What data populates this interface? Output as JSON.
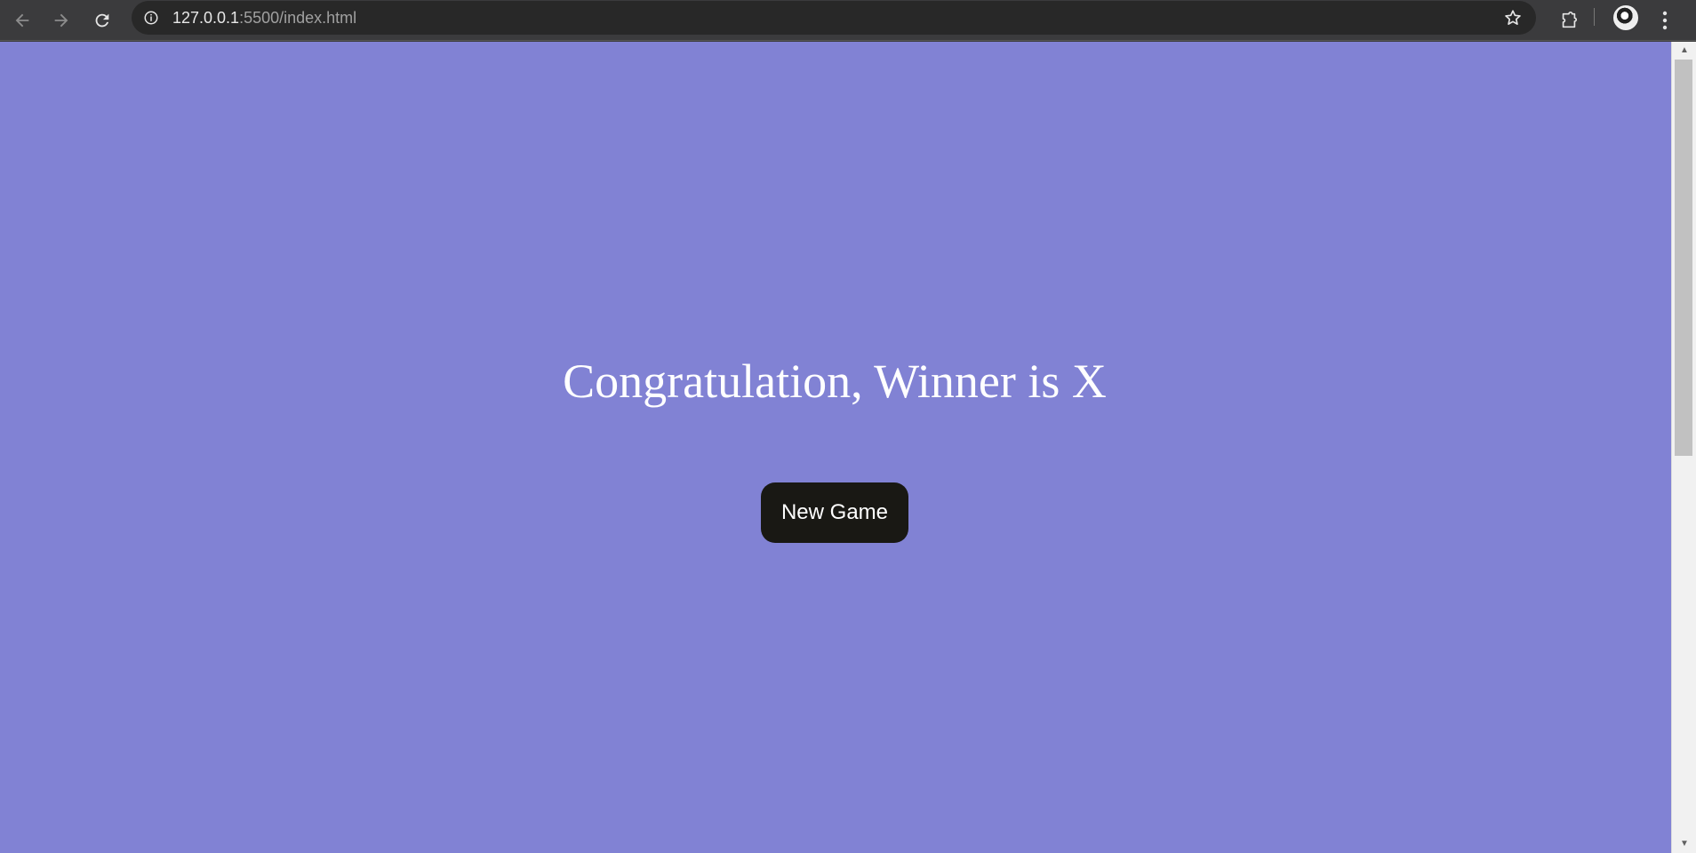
{
  "browser": {
    "url_host": "127.0.0.1",
    "url_rest": ":5500/index.html",
    "icons": {
      "back": "arrow-left-icon",
      "forward": "arrow-right-icon",
      "reload": "reload-icon",
      "site_info": "info-icon",
      "bookmark": "star-icon",
      "extensions": "puzzle-icon",
      "menu": "kebab-menu-icon"
    }
  },
  "page": {
    "background_color": "#8182d4",
    "message": "Congratulation, Winner is X",
    "new_game_label": "New Game",
    "button_color": "#191814"
  }
}
